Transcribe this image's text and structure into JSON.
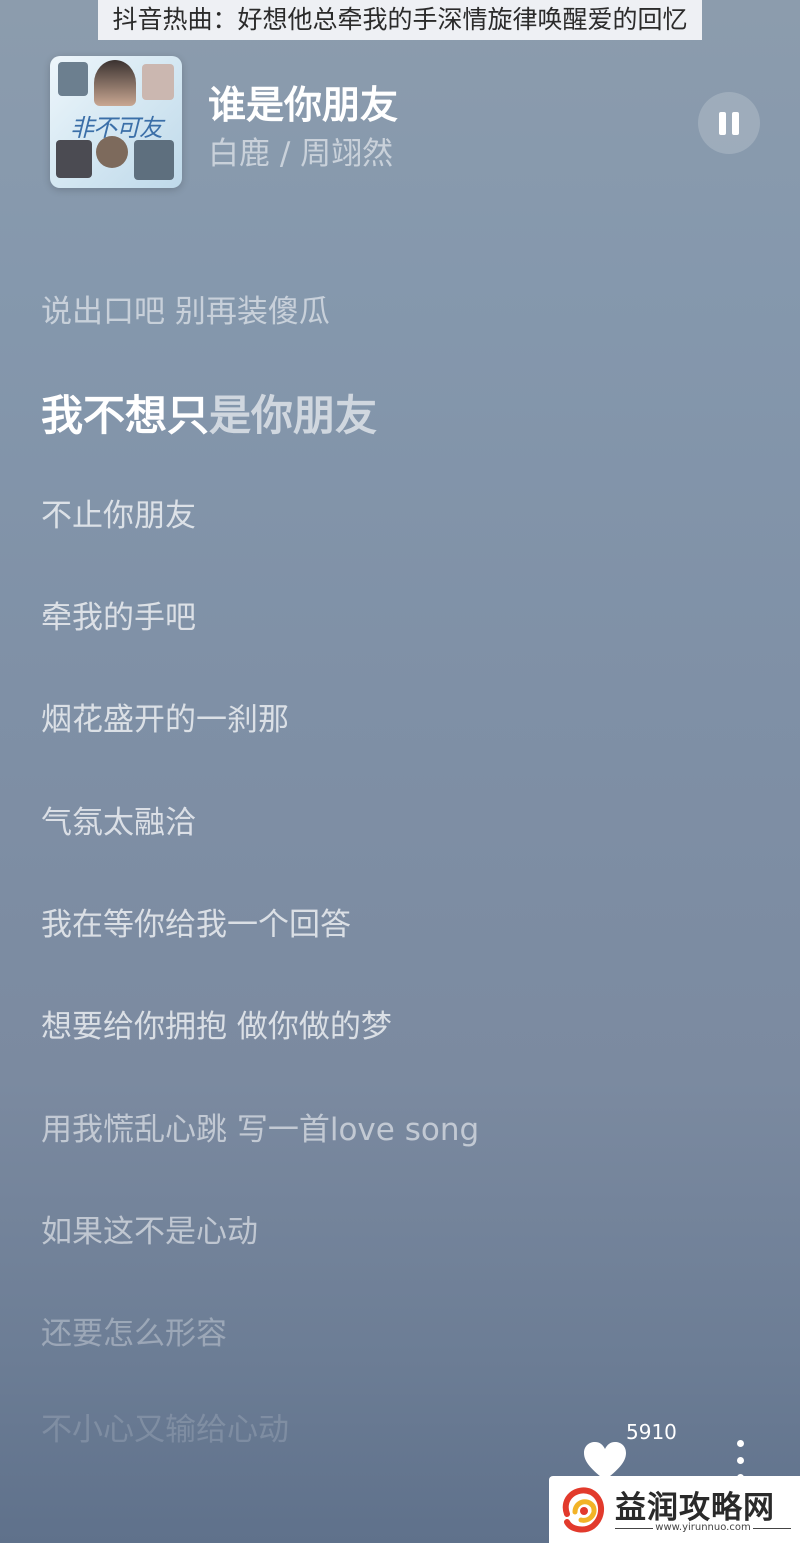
{
  "caption": "抖音热曲：好想他总牵我的手深情旋律唤醒爱的回忆",
  "player": {
    "cover_title": "非不可友",
    "song_title": "谁是你朋友",
    "artist": "白鹿 / 周翊然",
    "state": "playing"
  },
  "lyrics": {
    "previous": "说出口吧 别再装傻瓜",
    "current_sung": "我不想只",
    "current_unsung": "是你朋友",
    "upcoming": [
      "不止你朋友",
      "牵我的手吧",
      "烟花盛开的一刹那",
      "气氛太融洽",
      "我在等你给我一个回答",
      "想要给你拥抱 做你做的梦",
      "用我慌乱心跳 写一首love song",
      "如果这不是心动",
      "还要怎么形容",
      "不小心又输给心动"
    ]
  },
  "actions": {
    "like_count": "5910"
  },
  "watermark": {
    "name": "益润攻略网",
    "url": "www.yirunnuo.com"
  },
  "colors": {
    "background_top": "#8c9cad",
    "background_bottom": "#5f718b",
    "logo_red": "#e23a2c",
    "logo_yellow": "#f2b327"
  },
  "icons": [
    "pause-icon",
    "heart-icon",
    "more-vertical-icon",
    "site-logo-icon"
  ]
}
